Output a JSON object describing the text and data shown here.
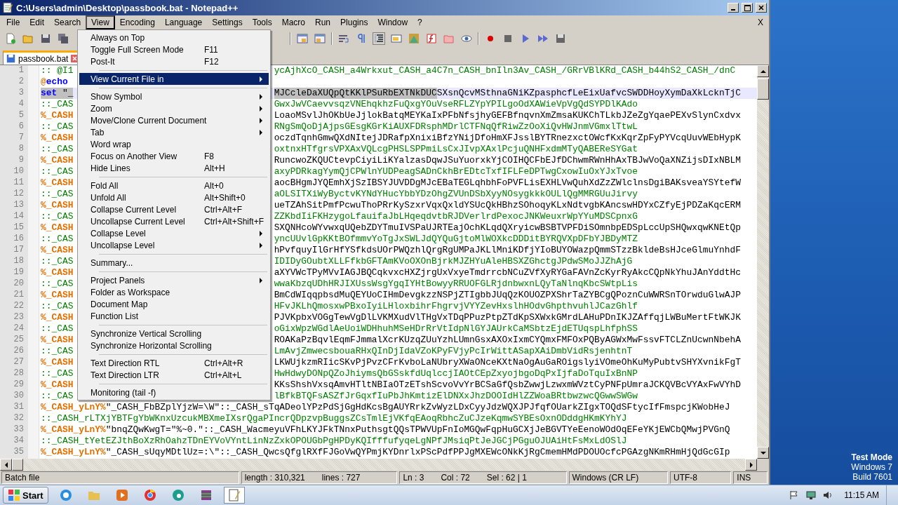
{
  "window": {
    "title": "C:\\Users\\admin\\Desktop\\passbook.bat - Notepad++"
  },
  "menu_bar": {
    "items": [
      {
        "label": "File",
        "selected": false
      },
      {
        "label": "Edit",
        "selected": false
      },
      {
        "label": "Search",
        "selected": false
      },
      {
        "label": "View",
        "selected": true
      },
      {
        "label": "Encoding",
        "selected": false
      },
      {
        "label": "Language",
        "selected": false
      },
      {
        "label": "Settings",
        "selected": false
      },
      {
        "label": "Tools",
        "selected": false
      },
      {
        "label": "Macro",
        "selected": false
      },
      {
        "label": "Run",
        "selected": false
      },
      {
        "label": "Plugins",
        "selected": false
      },
      {
        "label": "Window",
        "selected": false
      },
      {
        "label": "?",
        "selected": false
      }
    ],
    "close_label": "X"
  },
  "view_menu": {
    "items": [
      {
        "kind": "item",
        "label": "Always on Top",
        "submenu": false,
        "selected": false
      },
      {
        "kind": "item",
        "label": "Toggle Full Screen Mode",
        "shortcut": "F11",
        "submenu": false,
        "selected": false
      },
      {
        "kind": "item",
        "label": "Post-It",
        "shortcut": "F12",
        "submenu": false,
        "selected": false
      },
      {
        "kind": "separator"
      },
      {
        "kind": "item",
        "label": "View Current File in",
        "submenu": true,
        "selected": true
      },
      {
        "kind": "separator"
      },
      {
        "kind": "item",
        "label": "Show Symbol",
        "submenu": true,
        "selected": false
      },
      {
        "kind": "item",
        "label": "Zoom",
        "submenu": true,
        "selected": false
      },
      {
        "kind": "item",
        "label": "Move/Clone Current Document",
        "submenu": true,
        "selected": false
      },
      {
        "kind": "item",
        "label": "Tab",
        "submenu": true,
        "selected": false
      },
      {
        "kind": "item",
        "label": "Word wrap",
        "submenu": false,
        "selected": false
      },
      {
        "kind": "item",
        "label": "Focus on Another View",
        "shortcut": "F8",
        "submenu": false,
        "selected": false
      },
      {
        "kind": "item",
        "label": "Hide Lines",
        "shortcut": "Alt+H",
        "submenu": false,
        "selected": false
      },
      {
        "kind": "separator"
      },
      {
        "kind": "item",
        "label": "Fold All",
        "shortcut": "Alt+0",
        "submenu": false,
        "selected": false
      },
      {
        "kind": "item",
        "label": "Unfold All",
        "shortcut": "Alt+Shift+0",
        "submenu": false,
        "selected": false
      },
      {
        "kind": "item",
        "label": "Collapse Current Level",
        "shortcut": "Ctrl+Alt+F",
        "submenu": false,
        "selected": false
      },
      {
        "kind": "item",
        "label": "Uncollapse Current Level",
        "shortcut": "Ctrl+Alt+Shift+F",
        "submenu": false,
        "selected": false
      },
      {
        "kind": "item",
        "label": "Collapse Level",
        "submenu": true,
        "selected": false
      },
      {
        "kind": "item",
        "label": "Uncollapse Level",
        "submenu": true,
        "selected": false
      },
      {
        "kind": "separator"
      },
      {
        "kind": "item",
        "label": "Summary...",
        "submenu": false,
        "selected": false
      },
      {
        "kind": "separator"
      },
      {
        "kind": "item",
        "label": "Project Panels",
        "submenu": true,
        "selected": false
      },
      {
        "kind": "item",
        "label": "Folder as Workspace",
        "submenu": false,
        "selected": false
      },
      {
        "kind": "item",
        "label": "Document Map",
        "submenu": false,
        "selected": false
      },
      {
        "kind": "item",
        "label": "Function List",
        "submenu": false,
        "selected": false
      },
      {
        "kind": "separator"
      },
      {
        "kind": "item",
        "label": "Synchronize Vertical Scrolling",
        "submenu": false,
        "selected": false
      },
      {
        "kind": "item",
        "label": "Synchronize Horizontal Scrolling",
        "submenu": false,
        "selected": false
      },
      {
        "kind": "separator"
      },
      {
        "kind": "item",
        "label": "Text Direction RTL",
        "shortcut": "Ctrl+Alt+R",
        "submenu": false,
        "selected": false
      },
      {
        "kind": "item",
        "label": "Text Direction LTR",
        "shortcut": "Ctrl+Alt+L",
        "submenu": false,
        "selected": false
      },
      {
        "kind": "separator"
      },
      {
        "kind": "item",
        "label": "Monitoring (tail -f)",
        "submenu": false,
        "selected": false
      }
    ]
  },
  "tab": {
    "label": "passbook.bat"
  },
  "editor": {
    "lines": [
      {
        "number": "1",
        "current": false,
        "left": [
          {
            "text": ":: @I1",
            "kind": "comment"
          }
        ],
        "right": [
          {
            "text": "ycAjhXcO_CASH_a4Wrkxut_CASH_a4C7n_CASH_bnIln3Av_CASH_/GRrVBlKRd_CASH_b44hS2_CASH_/dnC",
            "kind": "comment"
          }
        ]
      },
      {
        "number": "2",
        "current": false,
        "left": [
          {
            "text": "@",
            "kind": "variable"
          },
          {
            "text": "echo",
            "kind": "keyword"
          }
        ]
      },
      {
        "number": "3",
        "current": true,
        "left": [
          {
            "text": "set",
            "kind": "keyword",
            "selected": true
          },
          {
            "text": " \"_",
            "kind": "plain",
            "selected": true
          }
        ],
        "right": [
          {
            "text": "MJCcleDaXUQpQtKKlPSuRbEXTNkDUC",
            "kind": "plain",
            "selected": true
          },
          {
            "text": "SXsnQcvMSthnaGNiKZpasphcfLeEixUafvcSWDDHoyXymDaXkLcknTjC",
            "kind": "plain",
            "selected": false
          }
        ]
      },
      {
        "number": "4",
        "current": false,
        "left": [
          {
            "text": "::_CAS",
            "kind": "comment"
          }
        ],
        "right": [
          {
            "text": "GwxJwVCaevvsqzVNEhqkhzFuQxgYOuVseRFLZYpYPILgoOdXAWieVpVgQdSYPDlKAdo",
            "kind": "comment"
          }
        ]
      },
      {
        "number": "5",
        "current": false,
        "left": [
          {
            "text": "%_CASH",
            "kind": "variable"
          }
        ],
        "right": [
          {
            "text": "LoaoMSvlJhOKbUeJjlokBatqMEYKaIxPFbNfsjhyGEFBfnqvnXmZmsaKUKChTLkbJZeZgYqaePEXvSlynCxdvx",
            "kind": "plain"
          }
        ]
      },
      {
        "number": "6",
        "current": false,
        "left": [
          {
            "text": "::_CAS",
            "kind": "comment"
          }
        ],
        "right": [
          {
            "text": "RNgSmQoDjAjpsGEsgKGrKiAUXFDRsphMDrlCTFNqQfRiwZzOoXiQvHWJnmVGmxlTtwL",
            "kind": "comment"
          }
        ]
      },
      {
        "number": "7",
        "current": false,
        "left": [
          {
            "text": "%_CASH",
            "kind": "variable"
          }
        ],
        "right": [
          {
            "text": "oczdTqnhGmwQXdNItejJDRafpXnixiBfzYNijDfoHmXFJsslBYTRnezxctOWcfKxKqrZpFyPYVcqUuvWEbHypK",
            "kind": "plain"
          }
        ]
      },
      {
        "number": "8",
        "current": false,
        "left": [
          {
            "text": "::_CAS",
            "kind": "comment"
          }
        ],
        "right": [
          {
            "text": "oxtnxHTfgrsVPXAxVQLcgPHSLSPPmiLsCxJIvpXAxlPcjuQNHFxdmMTyQABEReSYGat",
            "kind": "comment"
          }
        ]
      },
      {
        "number": "9",
        "current": false,
        "left": [
          {
            "text": "%_CASH",
            "kind": "variable"
          }
        ],
        "right": [
          {
            "text": "RuncwoZKQUCtevpCiyiLiKYalzasDqwJSuYuorxkYjCOIHQCFbEJfDChwmRWnHhAxTBJwVoQaXNZijsDIxNBLM",
            "kind": "plain"
          }
        ]
      },
      {
        "number": "10",
        "current": false,
        "left": [
          {
            "text": "::_CAS",
            "kind": "comment"
          }
        ],
        "right": [
          {
            "text": "axyPDRkagYymQjCPWlnYUDPeagSADnCkhBrEDtcTxfIFLFeDPTwgCxowIuOxYJxTvoe",
            "kind": "comment"
          }
        ]
      },
      {
        "number": "11",
        "current": false,
        "left": [
          {
            "text": "%_CASH",
            "kind": "variable"
          }
        ],
        "right": [
          {
            "text": "aocBHgmJYQEmhXjSzIBSYJUVDDgMJcEBaTEGLqhbhFoPVFLisEXHLVwQuhXdZzZWlclnsDgiBAKsveaYSYtefW",
            "kind": "plain"
          }
        ]
      },
      {
        "number": "12",
        "current": false,
        "left": [
          {
            "text": "::_CAS",
            "kind": "comment"
          }
        ],
        "right": [
          {
            "text": "aOLSITXiWyByctvKYNdYHucYbbYDzOhgZVUnDSbXyyNOsygkkkOULlQgMMRGUuJirvy",
            "kind": "comment"
          }
        ]
      },
      {
        "number": "13",
        "current": false,
        "left": [
          {
            "text": "%_CASH",
            "kind": "variable"
          }
        ],
        "right": [
          {
            "text": "ueTZAhSitPmfPcwuThoPRrKySzxrVqxQxldYSUcQkHBhzSOhoqyKLxNdtvgbKAncswHDYxCZfyEjPDZaKqcERM",
            "kind": "plain"
          }
        ]
      },
      {
        "number": "14",
        "current": false,
        "left": [
          {
            "text": "::_CAS",
            "kind": "comment"
          }
        ],
        "right": [
          {
            "text": "ZZKbdIiFKHzygoLfauifaJbLHqeqdvtbRJDVerlrdPexocJNKWeuxrWpYYuMDSCpnxG",
            "kind": "comment"
          }
        ]
      },
      {
        "number": "15",
        "current": false,
        "left": [
          {
            "text": "%_CASH",
            "kind": "variable"
          }
        ],
        "right": [
          {
            "text": "SXQNHcoWYvwxqUQebZDYTmuIVSPaUJRTEajOchKLqdQXryicwBSBTVPFDiSOmnbpEDSpLccUpSHQwxqwKNEtQp",
            "kind": "plain"
          }
        ]
      },
      {
        "number": "16",
        "current": false,
        "left": [
          {
            "text": "::_CAS",
            "kind": "comment"
          }
        ],
        "right": [
          {
            "text": "yncUUvlGpKKtBOfmmvYoTgJxSWLJdQYQuGjtoMlWOXkcDDDitBYRQVXpDFbYJBDyMTZ",
            "kind": "comment"
          }
        ]
      },
      {
        "number": "17",
        "current": false,
        "left": [
          {
            "text": "%_CASH",
            "kind": "variable"
          }
        ],
        "right": [
          {
            "text": "hPvfquyIlGrHfYSfkdsUOrPWQzhlQrgRgUMPaJKLlMniKDfjYIoBUYOWazpQmmSTzzBkldeBsHJceGlmuYnhdF",
            "kind": "plain"
          }
        ]
      },
      {
        "number": "18",
        "current": false,
        "left": [
          {
            "text": "::_CAS",
            "kind": "comment"
          }
        ],
        "right": [
          {
            "text": "IDIDyGOubtXLLFfkbGFTAmKVoOXOnBjrkMJZHYuAleHBSXZGhctgJPdwSMoJJZhAjG",
            "kind": "comment"
          }
        ]
      },
      {
        "number": "19",
        "current": false,
        "left": [
          {
            "text": "%_CASH",
            "kind": "variable"
          }
        ],
        "right": [
          {
            "text": "aXYVWcTPyMVvIAGJBQCqkvxcHXZjrgUxVxyeTmdrrcbNCuZVfXyRYGaFAVnZcKyrRyAkcCQpNkYhuJAnYddtHc",
            "kind": "plain"
          }
        ]
      },
      {
        "number": "20",
        "current": false,
        "left": [
          {
            "text": "::_CAS",
            "kind": "comment"
          }
        ],
        "right": [
          {
            "text": "wwaKbzqUDhHRJIXUssWsgYgqIYHtBowyyRRUOFGLRjdnbwxnLQyTaNlnqKbcSWtpLis",
            "kind": "comment"
          }
        ]
      },
      {
        "number": "21",
        "current": false,
        "left": [
          {
            "text": "%_CASH",
            "kind": "variable"
          }
        ],
        "right": [
          {
            "text": "BmCdWIqqpbsdMuQEYUoCIHmDevgkzzNSPjZTIgbbJUqQzKOUOZPXShrTaZYBCgQPoznCuWWRSnTOrwduGlwAJP",
            "kind": "plain"
          }
        ]
      },
      {
        "number": "22",
        "current": false,
        "left": [
          {
            "text": "::_CAS",
            "kind": "comment"
          }
        ],
        "right": [
          {
            "text": "HFvJKLhQmosxwPBxoIyiLHloxbihrFhgrvjVYYZevHxslhHOdvGhpthvuhlJCazGhlf",
            "kind": "comment"
          }
        ]
      },
      {
        "number": "23",
        "current": false,
        "left": [
          {
            "text": "%_CASH",
            "kind": "variable"
          }
        ],
        "right": [
          {
            "text": "PJVKpbxVOGgTewVgDlLVKMXudVlTHgVxTDqPPuzPtpZTdKpSXWxkGMrdLAHuPDnIKJZAffqjLWBuMertFtWKJK",
            "kind": "plain"
          }
        ]
      },
      {
        "number": "24",
        "current": false,
        "left": [
          {
            "text": "::_CAS",
            "kind": "comment"
          }
        ],
        "right": [
          {
            "text": "oGixWpzWGdlAeUoiWDHhuhMSeHDrRrVtIdpNlGYJAUrkCaMSbtzEjdETUqspLhfphSS",
            "kind": "comment"
          }
        ]
      },
      {
        "number": "25",
        "current": false,
        "left": [
          {
            "text": "%_CASH",
            "kind": "variable"
          }
        ],
        "right": [
          {
            "text": "ROAKaPzBqvlEqmFJmmalXcrKUzqZUuYzhLUmnGsxAXOxIxmCYQmxFMFOxPQByAGWxMwFssvFTCLZnUcwnNbehA",
            "kind": "plain"
          }
        ]
      },
      {
        "number": "26",
        "current": false,
        "left": [
          {
            "text": "::_CAS",
            "kind": "comment"
          }
        ],
        "right": [
          {
            "text": "LmAvjZmwecsbouaRHxQInDjIdaVZoKPyFVjyPcIrWittASapXAiDmbVidRsjenhtnT",
            "kind": "comment"
          }
        ]
      },
      {
        "number": "27",
        "current": false,
        "left": [
          {
            "text": "%_CASH",
            "kind": "variable"
          }
        ],
        "right": [
          {
            "text": "LKWUjkzmRIicSKvPjPvzCFrKvboLaNUbryXWaONceKXtNaOgAuGaROigslyiVOmeOhKuMyPubtvSHYXvnikFgT",
            "kind": "plain"
          }
        ]
      },
      {
        "number": "28",
        "current": false,
        "left": [
          {
            "text": "::_CAS",
            "kind": "comment"
          }
        ],
        "right": [
          {
            "text": "HwHdwyDONpQZoJhiymsQbGSskfdUqlccjIAOtCEpZxyojbgoDqPxIjfaDoTquIxBnNP",
            "kind": "comment"
          }
        ]
      },
      {
        "number": "29",
        "current": false,
        "left": [
          {
            "text": "%_CASH",
            "kind": "variable"
          }
        ],
        "right": [
          {
            "text": "KKsShshVxsqAmvHTltNBIaOTzETshScvoVvYrBCSaGfQsbZwwjLzwxmWVztCyPNFpUmraJCKQVBcVYAxFwVYhD",
            "kind": "plain"
          }
        ]
      },
      {
        "number": "30",
        "current": false,
        "left": [
          {
            "text": "::_CAS",
            "kind": "comment"
          }
        ],
        "right": [
          {
            "text": "lBfkBTQFsASZfJrGqxfIuPbJhKmtizElDNXxJhzDOOIdHlZZWoaBRtbwzwcQGwwSWGw",
            "kind": "comment"
          }
        ]
      },
      {
        "number": "31",
        "current": false,
        "left": [
          {
            "text": "%_CASH_yLnY%",
            "kind": "variable"
          },
          {
            "text": "\"_CASH_FbBZplYjzW=\\W\"::_CASH_sTqADeolYPzPdSjGgHdKcsBgAUYRrkZvWyzLDxCyyJdzWQXJPJfqfOUarkZIgxTOQdSFtycIfFmspcjKWobHeJ",
            "kind": "plain"
          }
        ]
      },
      {
        "number": "32",
        "current": false,
        "left": [
          {
            "text": "::_CASH_rLTXjYBTFgYbWKnxUzcukMBXmeIXsrQgaPIncrQDpzvpBuggsZCsTmlEjVKfqEAoqRbhcZuCJzeKqmwSYBEsOxnODddgHKmKYhYJ",
            "kind": "comment"
          }
        ]
      },
      {
        "number": "33",
        "current": false,
        "left": [
          {
            "text": "%_CASH_yLnY%",
            "kind": "variable"
          },
          {
            "text": "\"bnqZQwKwgT=\"%~0.\"::_CASH_WacmeyuVFhLKYJFkTNnxPuthsgtQQsTPWVUpFnIoMGQwFqpHuGCXjJeBGVTYeEenoWOdOqEFeYKjEWCbQMwjPVGnQ",
            "kind": "plain"
          }
        ]
      },
      {
        "number": "34",
        "current": false,
        "left": [
          {
            "text": "::_CASH_tYetEZJthBoXzRhOahzTDnEYVoVYntLinNzZxkOPOUGbPgHPDyKQIfffufyqeLgNPfJMsiqPtJeJGCjPGguOJUAiHtFsMxLdOSlJ",
            "kind": "comment"
          }
        ]
      },
      {
        "number": "35",
        "current": false,
        "left": [
          {
            "text": "%_CASH_yLnY%",
            "kind": "variable"
          },
          {
            "text": "\"_CASH_sUqyMDtlUz=:\\\"::_CASH_QwcsQfglRXfFJGoVwQYPmjKYDnrlxPScPdfPPJgMXEWcONkKjRgCmemHMdPDOUOcfcPGAzgNKmRHmHjQdGcGIp",
            "kind": "plain"
          }
        ]
      }
    ]
  },
  "status_bar": {
    "file_type": "Batch file",
    "length": "length : 310,321",
    "lines": "lines : 727",
    "line": "Ln : 3",
    "column": "Col : 72",
    "selection": "Sel : 62 | 1",
    "eol": "Windows (CR LF)",
    "encoding": "UTF-8",
    "mode": "INS"
  },
  "desktop": {
    "notice": [
      "Test Mode",
      "Windows 7",
      "Build 7601"
    ]
  },
  "taskbar": {
    "start": "Start",
    "clock": "11:15 AM"
  }
}
